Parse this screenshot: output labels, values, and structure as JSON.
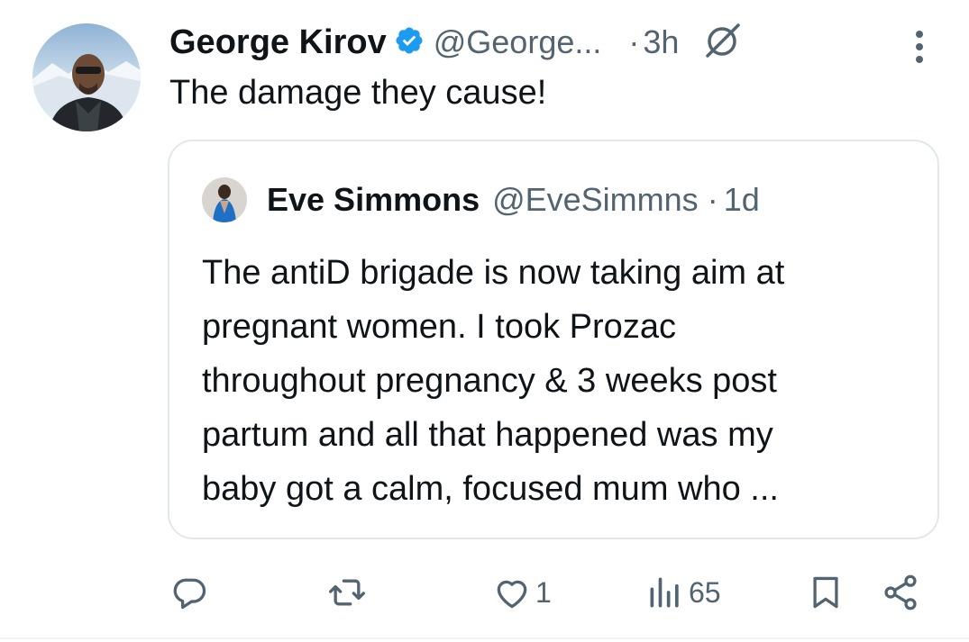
{
  "post": {
    "author_name": "George Kirov",
    "author_handle": "@George...",
    "separator": "·",
    "time": "3h",
    "text": "The damage they cause!",
    "verified": true
  },
  "quote": {
    "author_name": "Eve Simmons",
    "author_handle": "@EveSimmns",
    "separator": "·",
    "time": "1d",
    "lines": [
      "The antiD brigade is now taking aim at",
      "pregnant women. I took Prozac",
      "throughout pregnancy & 3 weeks post",
      "partum and all that happened was my",
      "baby got a calm, focused mum who ..."
    ]
  },
  "actions": {
    "reply_count": "",
    "repost_count": "",
    "like_count": "1",
    "views_count": "65"
  },
  "icons": {
    "verified": "verified-badge-icon",
    "grok": "grok-icon",
    "more": "more-vertical-icon",
    "reply": "reply-icon",
    "repost": "repost-icon",
    "like": "heart-icon",
    "views": "views-icon",
    "bookmark": "bookmark-icon",
    "share": "share-icon"
  },
  "colors": {
    "verified_blue": "#1d9bf0",
    "secondary_text": "#536471",
    "primary_text": "#0f1419",
    "border": "#e1e8ed"
  }
}
